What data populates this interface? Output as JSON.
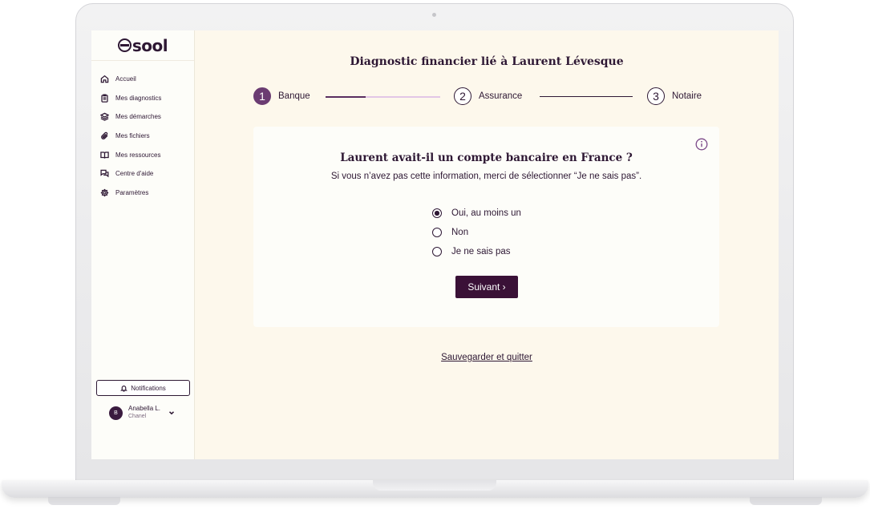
{
  "app": {
    "logo": "sool"
  },
  "sidebar": {
    "items": [
      {
        "label": "Accueil",
        "icon": "home-icon"
      },
      {
        "label": "Mes diagnostics",
        "icon": "clipboard-icon"
      },
      {
        "label": "Mes démarches",
        "icon": "layers-icon"
      },
      {
        "label": "Mes fichiers",
        "icon": "paperclip-icon"
      },
      {
        "label": "Mes ressources",
        "icon": "book-icon"
      },
      {
        "label": "Centre d'aide",
        "icon": "chat-icon"
      },
      {
        "label": "Paramètres",
        "icon": "gear-icon"
      }
    ],
    "notifications_label": "Notifications",
    "user": {
      "initial": "B",
      "name": "Anabella L.",
      "subtitle": "Chanel"
    }
  },
  "main": {
    "title": "Diagnostic financier lié à Laurent Lévesque",
    "steps": [
      {
        "number": "1",
        "label": "Banque",
        "active": true
      },
      {
        "number": "2",
        "label": "Assurance",
        "active": false
      },
      {
        "number": "3",
        "label": "Notaire",
        "active": false
      }
    ],
    "progress_step1": 0.35,
    "question": "Laurent avait-il un compte bancaire en France ?",
    "hint": "Si vous n’avez pas cette information, merci de sélectionner “Je ne sais pas”.",
    "options": [
      {
        "label": "Oui, au moins un",
        "checked": true
      },
      {
        "label": "Non",
        "checked": false
      },
      {
        "label": "Je ne sais pas",
        "checked": false
      }
    ],
    "next_label": "Suivant ›",
    "save_label": "Sauvegarder et quitter"
  },
  "colors": {
    "accent": "#3a1137",
    "step_active": "#6b3c72",
    "background": "#fdf8ec"
  }
}
